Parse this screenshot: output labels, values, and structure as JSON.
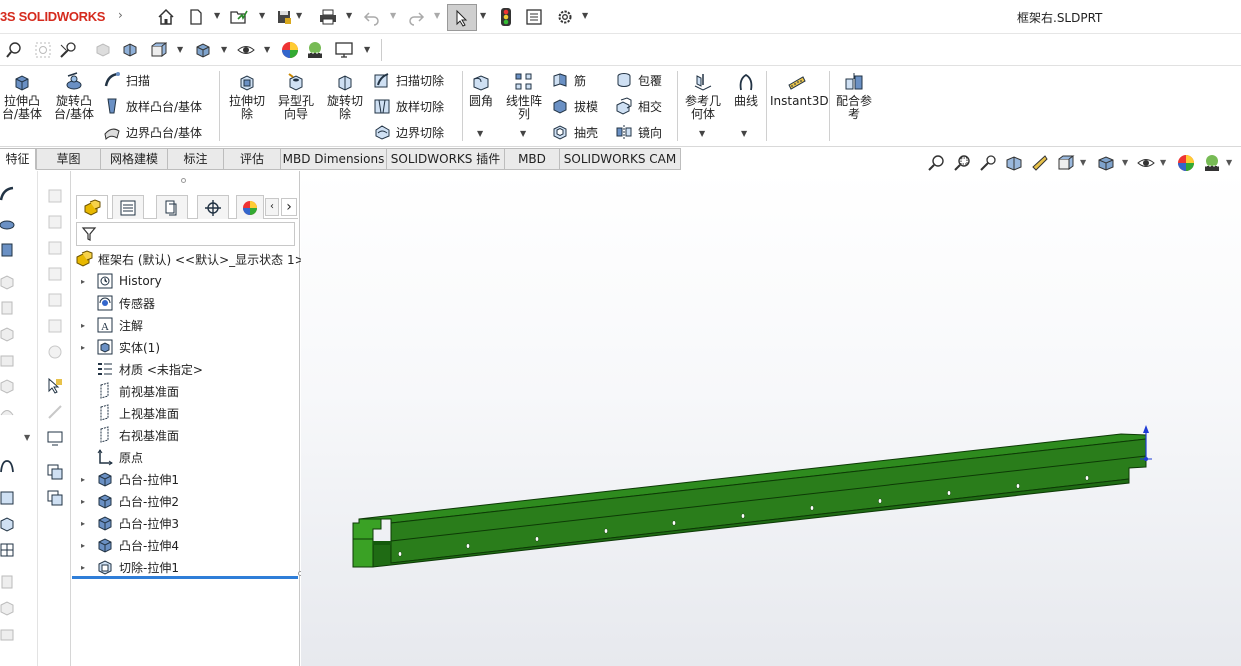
{
  "titlebar": {
    "app_logo": "SOLIDWORKS",
    "logo_prefix": "3S",
    "document_title": "框架右.SLDPRT",
    "icons": [
      "home-icon",
      "new-document-icon",
      "open-icon",
      "save-icon",
      "print-icon",
      "undo-icon",
      "redo-icon",
      "select-arrow-icon",
      "rebuild-traffic-light-icon",
      "file-properties-icon",
      "options-gear-icon"
    ]
  },
  "command_manager": {
    "extrude_boss": "拉伸凸台/基体",
    "revolve_boss": "旋转凸台/基体",
    "sweep": "扫描",
    "loft_boss": "放样凸台/基体",
    "boundary_boss": "边界凸台/基体",
    "extrude_cut": "拉伸切除",
    "hole_wizard": "异型孔向导",
    "revolve_cut": "旋转切除",
    "sweep_cut": "扫描切除",
    "loft_cut": "放样切除",
    "boundary_cut": "边界切除",
    "fillet": "圆角",
    "linear_pattern": "线性阵列",
    "rib": "筋",
    "draft": "拔模",
    "shell": "抽壳",
    "wrap": "包覆",
    "intersect": "相交",
    "mirror": "镜向",
    "reference_geometry": "参考几何体",
    "curves": "曲线",
    "instant3d": "Instant3D",
    "mate_reference": "配合参考"
  },
  "tabs": [
    "特征",
    "草图",
    "网格建模",
    "标注",
    "评估",
    "MBD Dimensions",
    "SOLIDWORKS 插件",
    "MBD",
    "SOLIDWORKS CAM"
  ],
  "feature_tree": {
    "root": "框架右 (默认) <<默认>_显示状态 1>",
    "items": [
      {
        "label": "History",
        "expandable": true
      },
      {
        "label": "传感器",
        "expandable": false
      },
      {
        "label": "注解",
        "expandable": true
      },
      {
        "label": "实体(1)",
        "expandable": true
      },
      {
        "label": "材质 <未指定>",
        "expandable": false
      },
      {
        "label": "前视基准面",
        "expandable": false
      },
      {
        "label": "上视基准面",
        "expandable": false
      },
      {
        "label": "右视基准面",
        "expandable": false
      },
      {
        "label": "原点",
        "expandable": false
      },
      {
        "label": "凸台-拉伸1",
        "expandable": true
      },
      {
        "label": "凸台-拉伸2",
        "expandable": true
      },
      {
        "label": "凸台-拉伸3",
        "expandable": true
      },
      {
        "label": "凸台-拉伸4",
        "expandable": true
      },
      {
        "label": "切除-拉伸1",
        "expandable": true
      }
    ]
  },
  "colors": {
    "part_green": "#2e8b1e",
    "part_dark_green": "#1a5c10",
    "selection_blue": "#1f3bd6",
    "brand_red": "#d52b1e"
  }
}
